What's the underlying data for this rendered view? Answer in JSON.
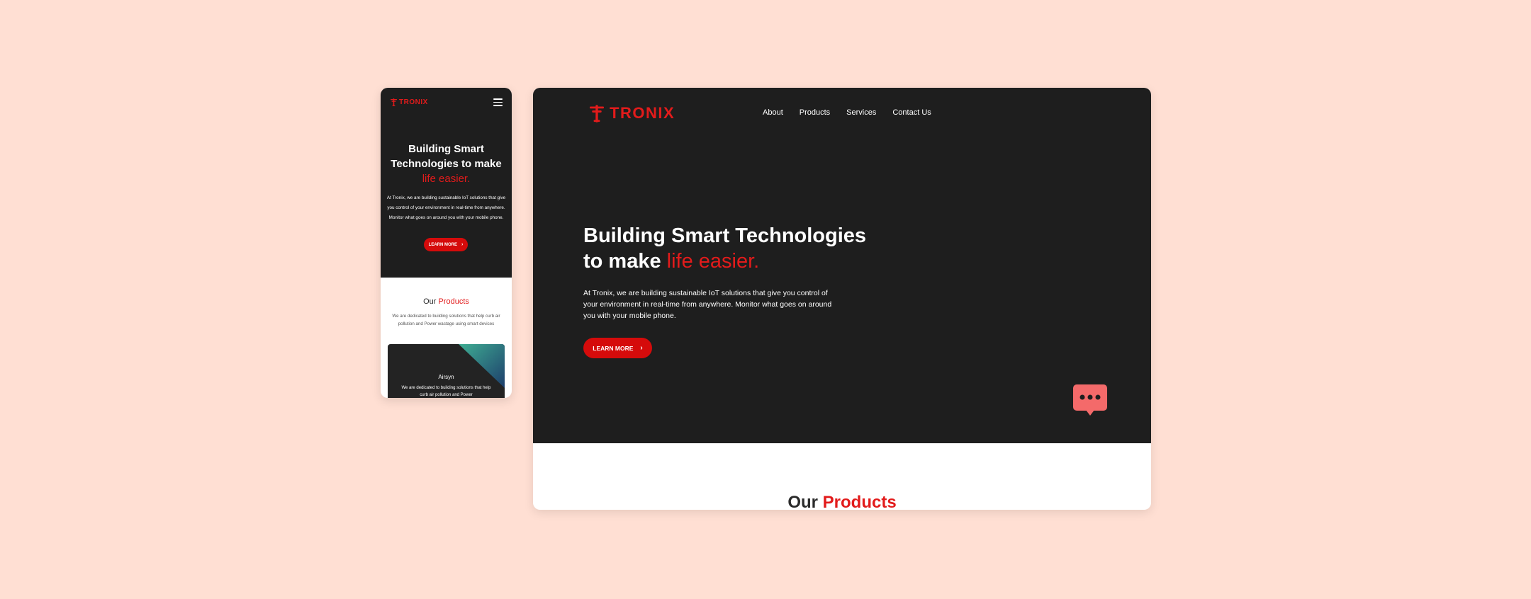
{
  "brand": {
    "name": "TRONIX",
    "color": "#e21b1b",
    "logo_icon": "antenna-tower-icon"
  },
  "colors": {
    "background": "#ffdfd3",
    "hero": "#1e1e1e",
    "accent": "#e21b1b",
    "button": "#d50b0b",
    "chat": "#f46a6a"
  },
  "mobile": {
    "menu_icon": "hamburger-icon",
    "hero": {
      "title_line1": "Building Smart",
      "title_line2": "Technologies to make",
      "title_highlight": "life easier.",
      "body": "At Tronix, we are building sustainable  IoT solutions that give you control of your environment in real-time from anywhere. Monitor what goes on around you with your mobile phone.",
      "button_label": "LEARN MORE",
      "button_icon": "chevron-right-icon"
    },
    "products": {
      "title_prefix": "Our",
      "title_highlight": "Products",
      "description": "We are dedicated to building solutions that help curb air pollution and  Power wastage using smart devices",
      "card": {
        "name": "Airsyn",
        "description": "We are dedicated to building solutions that help curb air pollution and  Power"
      }
    }
  },
  "desktop": {
    "nav": [
      "About",
      "Products",
      "Services",
      "Contact Us"
    ],
    "hero": {
      "title_line1": "Building Smart Technologies",
      "title_line2_prefix": "to make",
      "title_highlight": "life easier.",
      "body": "At Tronix, we are building sustainable  IoT solutions that give you control of your environment in real-time from anywhere. Monitor what goes on around you with your mobile phone.",
      "button_label": "LEARN MORE",
      "button_icon": "chevron-right-icon"
    },
    "chat_icon": "chat-bubble-icon",
    "products": {
      "title_prefix": "Our",
      "title_highlight": "Products"
    }
  }
}
